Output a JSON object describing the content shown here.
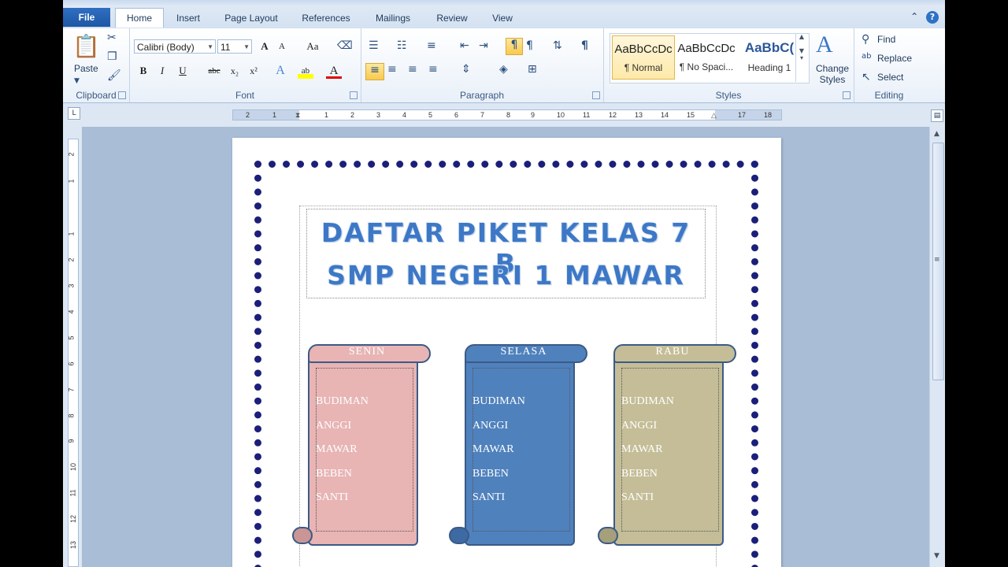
{
  "tabs": [
    "File",
    "Home",
    "Insert",
    "Page Layout",
    "References",
    "Mailings",
    "Review",
    "View"
  ],
  "clipboard": {
    "paste_label": "Paste",
    "group_label": "Clipboard"
  },
  "font": {
    "family": "Calibri (Body)",
    "size": "11",
    "group_label": "Font",
    "grow": "A",
    "shrink": "A",
    "case": "Aa",
    "bold": "B",
    "italic": "I",
    "underline": "U",
    "strike": "abc",
    "sub": "x₂",
    "sup": "x²",
    "effects": "A",
    "highlight": "ab",
    "color": "A"
  },
  "paragraph": {
    "group_label": "Paragraph",
    "pilcrow": "¶"
  },
  "styles": {
    "group_label": "Styles",
    "change_styles": "Change Styles",
    "tiles": [
      {
        "preview": "AaBbCcDc",
        "name": "¶ Normal"
      },
      {
        "preview": "AaBbCcDc",
        "name": "¶ No Spaci..."
      },
      {
        "preview": "AaBbC(",
        "name": "Heading 1"
      }
    ]
  },
  "editing": {
    "group_label": "Editing",
    "find": "Find",
    "replace": "Replace",
    "select": "Select"
  },
  "ruler_numbers": [
    "2",
    "1",
    "1",
    "2",
    "3",
    "4",
    "5",
    "6",
    "7",
    "8",
    "9",
    "10",
    "11",
    "12",
    "13",
    "14",
    "15",
    "17",
    "18"
  ],
  "vruler_numbers": [
    "2",
    "1",
    "1",
    "2",
    "3",
    "4",
    "5",
    "6",
    "7",
    "8",
    "9",
    "10",
    "11",
    "12",
    "13"
  ],
  "document": {
    "title_line1": "DAFTAR PIKET KELAS 7 B",
    "title_line2": "SMP NEGERI 1 MAWAR",
    "scrolls": [
      {
        "title": "SENIN",
        "color": "#e8b4b4",
        "names": [
          "BUDIMAN",
          "ANGGI",
          "MAWAR",
          "BEBEN",
          "SANTI"
        ]
      },
      {
        "title": "SELASA",
        "color": "#4f81bd",
        "names": [
          "BUDIMAN",
          "ANGGI",
          "MAWAR",
          "BEBEN",
          "SANTI"
        ]
      },
      {
        "title": "RABU",
        "color": "#c4bd97",
        "names": [
          "BUDIMAN",
          "ANGGI",
          "MAWAR",
          "BEBEN",
          "SANTI"
        ]
      }
    ]
  },
  "colors": {
    "accent": "#2b579a",
    "page_border": "#1b1f7a",
    "title": "#3d78c6"
  }
}
